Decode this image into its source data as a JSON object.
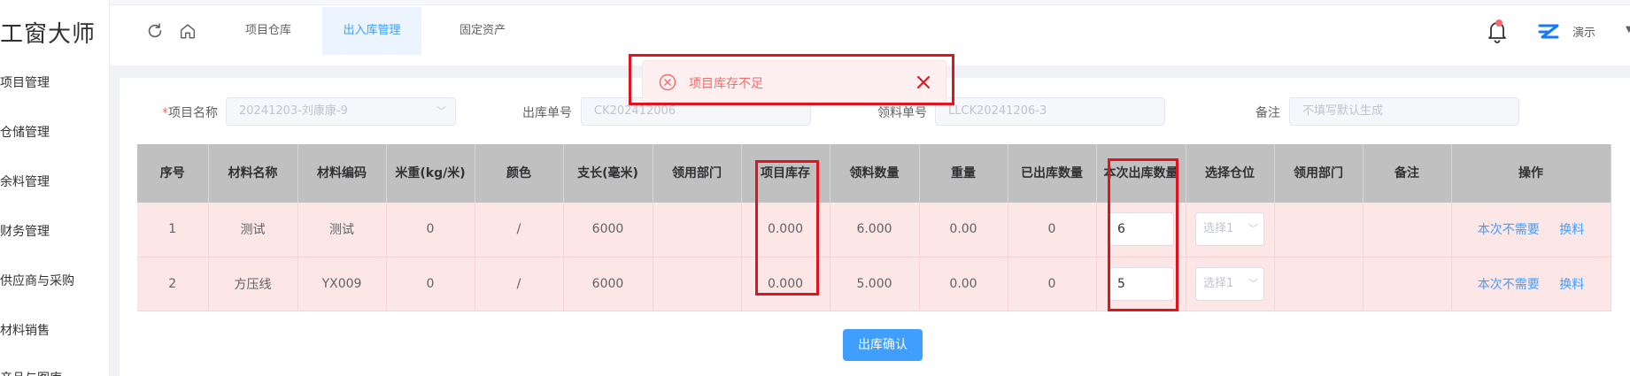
{
  "app": {
    "title": "工窗大师"
  },
  "sidebar": {
    "items": [
      {
        "label": "项目管理"
      },
      {
        "label": "仓储管理"
      },
      {
        "label": "余料管理"
      },
      {
        "label": "财务管理"
      },
      {
        "label": "供应商与采购"
      },
      {
        "label": "材料销售"
      },
      {
        "label": "产品与图库"
      }
    ]
  },
  "header": {
    "tabs": [
      {
        "label": "项目仓库"
      },
      {
        "label": "出入库管理"
      },
      {
        "label": "固定资产"
      }
    ],
    "user_name": "演示",
    "icons": {
      "refresh": "refresh-icon",
      "home": "home-icon",
      "bell": "bell-icon"
    }
  },
  "form": {
    "project_name_label": "项目名称",
    "required_mark": "*",
    "project_name_value": "20241203-刘康康-9",
    "out_no_label": "出库单号",
    "out_no_value": "CK202412006",
    "pick_no_label": "领料单号",
    "pick_no_value": "LLCK20241206-3",
    "remark_label": "备注",
    "remark_placeholder": "不填写默认生成"
  },
  "table": {
    "headers": [
      "序号",
      "材料名称",
      "材料编码",
      "米重(kg/米)",
      "颜色",
      "支长(毫米)",
      "领用部门",
      "项目库存",
      "领料数量",
      "重量",
      "已出库数量",
      "本次出库数量",
      "选择仓位",
      "领用部门",
      "备注",
      "操作"
    ],
    "rows": [
      {
        "index": "1",
        "name": "测试",
        "code": "测试",
        "meter_weight": "0",
        "color": "/",
        "length": "6000",
        "dept": "",
        "stock": "0.000",
        "pick_qty": "6.000",
        "weight": "0.00",
        "out_qty": "0",
        "this_qty": "6",
        "location_placeholder": "选择1",
        "dept2": "",
        "remark": "",
        "op_skip": "本次不需要",
        "op_swap": "换料"
      },
      {
        "index": "2",
        "name": "方压线",
        "code": "YX009",
        "meter_weight": "0",
        "color": "/",
        "length": "6000",
        "dept": "",
        "stock": "0.000",
        "pick_qty": "5.000",
        "weight": "0.00",
        "out_qty": "0",
        "this_qty": "5",
        "location_placeholder": "选择1",
        "dept2": "",
        "remark": "",
        "op_skip": "本次不需要",
        "op_swap": "换料"
      }
    ]
  },
  "confirm_label": "出库确认",
  "toast": {
    "message": "项目库存不足"
  },
  "colors": {
    "primary": "#409eff",
    "error": "#f56c6c",
    "row_error_bg": "#fde6e6",
    "header_bg": "#c0c0c0",
    "annotation": "#e0141e"
  }
}
